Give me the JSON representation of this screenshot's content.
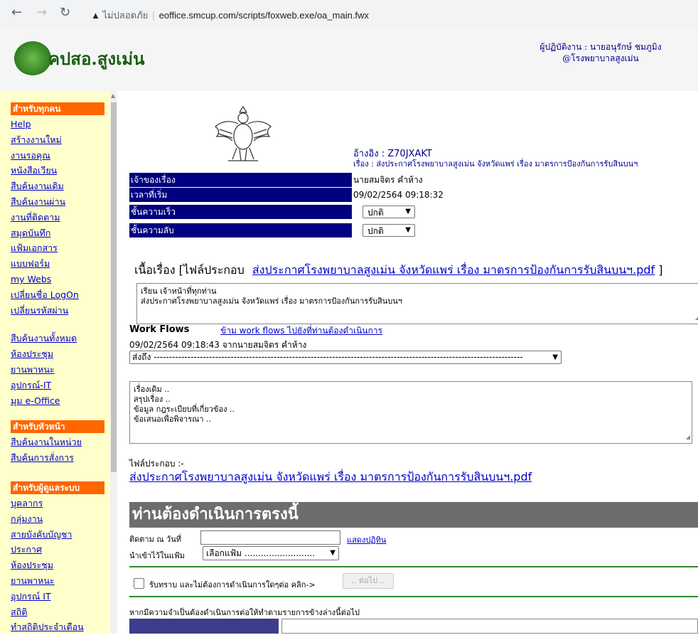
{
  "browser": {
    "security_label": "ไม่ปลอดภัย",
    "url": "eoffice.smcup.com/scripts/foxweb.exe/oa_main.fwx"
  },
  "header": {
    "site_title": "คปสอ.สูงเม่น",
    "user_line1": "ผู้ปฏิบัติงาน : นายอนุรักษ์ ชมภูมิง",
    "user_line2": "@โรงพยาบาลสูงเม่น"
  },
  "sidebar": {
    "groups": [
      {
        "title": "สำหรับทุกคน",
        "items": [
          "Help",
          "สร้างงานใหม่",
          "งานรอคุณ",
          "หนังสือเวียน",
          "สืบค้นงานเดิม",
          "สืบค้นงานผ่าน",
          "งานที่ติดตาม",
          "สมุดบันทึก",
          "แฟ้มเอกสาร",
          "แบบฟอร์ม",
          "my Webs",
          "เปลี่ยนชื่อ LogOn",
          "เปลี่ยนรหัสผ่าน"
        ]
      },
      {
        "title": "",
        "items": [
          "สืบค้นงานทั้งหมด",
          "ห้องประชุม",
          "ยานพาหนะ",
          "อุปกรณ์-IT",
          "มุม e-Office"
        ]
      },
      {
        "title": "สำหรับหัวหน้า",
        "items": [
          "สืบค้นงานในหน่วย",
          "สืบค้นการสั่งการ"
        ]
      },
      {
        "title": "สำหรับผู้ดูแลระบบ",
        "items": [
          "บุคลากร",
          "กลุ่มงาน",
          "สายบังคับบัญชา",
          "ประกาศ",
          "ห้องประชุม",
          "ยานพาหนะ",
          "อุปกรณ์ IT",
          "สถิติ",
          "ทำสถิติประจำเดือน"
        ]
      }
    ]
  },
  "document": {
    "ref_label": "อ้างอิง : Z70JXAKT",
    "subject_label": "เรื่อง : ส่งประกาศโรงพยาบาลสูงเม่น จังหวัดแพร่ เรื่อง มาตรการป้องกันการรับสินบนฯ",
    "owner_label": "เจ้าของเรื่อง",
    "owner_value": "นายสมจิตร คำห้าง",
    "start_label": "เวลาที่เริ่ม",
    "start_value": "09/02/2564 09:18:32",
    "speed_label": "ชั้นความเร็ว",
    "speed_value": "ปกติ",
    "secret_label": "ชั้นความลับ",
    "secret_value": "ปกติ",
    "body_prefix": "เนื้อเรื่อง [ไฟล์ประกอบ",
    "body_file": "ส่งประกาศโรงพยาบาลสูงเม่น จังหวัดแพร่ เรื่อง มาตรการป้องกันการรับสินบนฯ.pdf",
    "body_suffix": "]",
    "body_text_line1": "เรียน  เจ้าหน้าที่ทุกท่าน",
    "body_text_line2": "ส่งประกาศโรงพยาบาลสูงเม่น จังหวัดแพร่ เรื่อง มาตรการป้องกันการรับสินบนฯ"
  },
  "workflow": {
    "title": "Work Flows",
    "skip_link": "ข้าม work flows ไปยังที่ท่านต้องดำเนินการ",
    "entry": "09/02/2564 09:18:43 จากนายสมจิตร คำห้าง",
    "send_to": "ส่งถึง ------------------------------------------------------------------------------------------------------------------------",
    "notes_line1": "เรื่องเดิม ..",
    "notes_line2": "สรุปเรื่อง ..",
    "notes_line3": "ข้อมูล กฎระเบียบที่เกี่ยวข้อง ..",
    "notes_line4": "ข้อเสนอเพื่อพิจารณา ..",
    "attach_label": "ไฟล์ประกอบ :-",
    "attach_file": "ส่งประกาศโรงพยาบาลสูงเม่น จังหวัดแพร่ เรื่อง มาตรการป้องกันการรับสินบนฯ.pdf"
  },
  "action": {
    "heading": "ท่านต้องดำเนินการตรงนี้",
    "follow_label": "ติดตาม ณ วันที่",
    "follow_value": "",
    "calendar_link": "แสดงปฏิทิน",
    "folder_label": "นำเข้าไว้ในแฟ้ม",
    "folder_value": "เลือกแฟ้ม ..........................",
    "ack_text": "รับทราบ และไม่ต้องการดำเนินการใดๆต่อ คลิก->",
    "next_button": ".. ต่อไป ..",
    "note": "หากมีความจำเป็นต้องดำเนินการต่อให้ทำตามรายการข้างล่างนี้ต่อไป"
  },
  "colors": {
    "sidebar_bg": "#ffffcc",
    "group_header": "#ff6600",
    "label_bg": "#000080",
    "action_bar": "#6d6d6d"
  }
}
